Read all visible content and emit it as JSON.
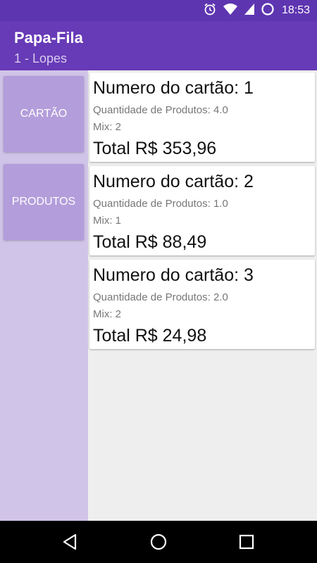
{
  "status_bar": {
    "time": "18:53",
    "icons": [
      "alarm-icon",
      "wifi-icon",
      "signal-icon",
      "battery-icon"
    ]
  },
  "app_bar": {
    "title": "Papa-Fila",
    "subtitle": "1 - Lopes"
  },
  "sidebar": {
    "buttons": [
      {
        "label": "CARTÃO"
      },
      {
        "label": "PRODUTOS"
      }
    ]
  },
  "cards": [
    {
      "title": "Numero do cartão: 1",
      "qty": "Quantidade de Produtos: 4.0",
      "mix": "Mix: 2",
      "total": "Total R$ 353,96"
    },
    {
      "title": "Numero do cartão: 2",
      "qty": "Quantidade de Produtos: 1.0",
      "mix": "Mix: 1",
      "total": "Total R$ 88,49"
    },
    {
      "title": "Numero do cartão: 3",
      "qty": "Quantidade de Produtos: 2.0",
      "mix": "Mix: 2",
      "total": "Total R$ 24,98"
    }
  ],
  "nav_bar": {
    "icons": [
      "back-icon",
      "home-icon",
      "recents-icon"
    ]
  },
  "colors": {
    "primary": "#673ab7",
    "primary_dark": "#5e35b1",
    "sidebar_bg": "#d1c4e9",
    "button_bg": "#b39ddb"
  }
}
